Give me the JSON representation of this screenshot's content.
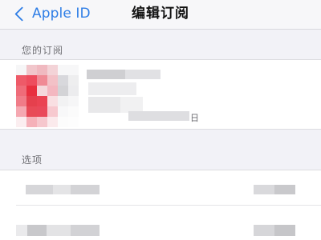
{
  "navbar": {
    "back_label": "Apple ID",
    "title": "编辑订阅"
  },
  "sections": {
    "subscriptions_header": "您的订阅",
    "options_header": "选项"
  },
  "subscription": {
    "date_suffix": "日",
    "icon_color": "#e8505b"
  },
  "icons": {
    "back": "chevron-left-icon",
    "app": "app-icon"
  },
  "colors": {
    "accent": "#2f7ee6",
    "background": "#f2f2f7"
  }
}
